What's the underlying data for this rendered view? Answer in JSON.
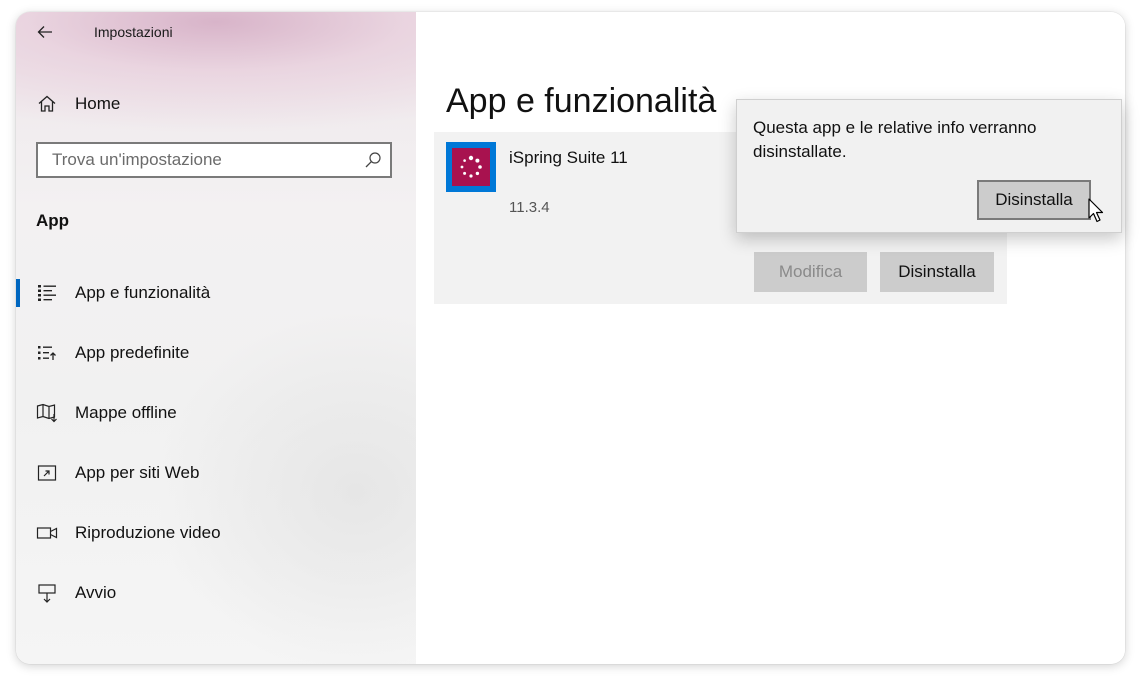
{
  "window": {
    "title": "Impostazioni"
  },
  "sidebar": {
    "home_label": "Home",
    "search_placeholder": "Trova un'impostazione",
    "section_heading": "App",
    "items": [
      {
        "label": "App e funzionalità",
        "icon": "apps-features-icon",
        "active": true
      },
      {
        "label": "App predefinite",
        "icon": "default-apps-icon",
        "active": false
      },
      {
        "label": "Mappe offline",
        "icon": "offline-maps-icon",
        "active": false
      },
      {
        "label": "App per siti Web",
        "icon": "apps-for-websites-icon",
        "active": false
      },
      {
        "label": "Riproduzione video",
        "icon": "video-playback-icon",
        "active": false
      },
      {
        "label": "Avvio",
        "icon": "startup-icon",
        "active": false
      }
    ]
  },
  "main": {
    "page_title": "App e funzionalità",
    "app": {
      "name": "iSpring Suite 11",
      "version": "11.3.4",
      "icon": "ispring-app-icon",
      "modify_label": "Modifica",
      "uninstall_label": "Disinstalla"
    }
  },
  "flyout": {
    "message": "Questa app e le relative info verranno disinstallate.",
    "confirm_label": "Disinstalla"
  },
  "colors": {
    "accent": "#0067c0",
    "app_icon_bg": "#0078d7",
    "app_icon_inner": "#a8124f",
    "button_bg": "#cccccc"
  }
}
